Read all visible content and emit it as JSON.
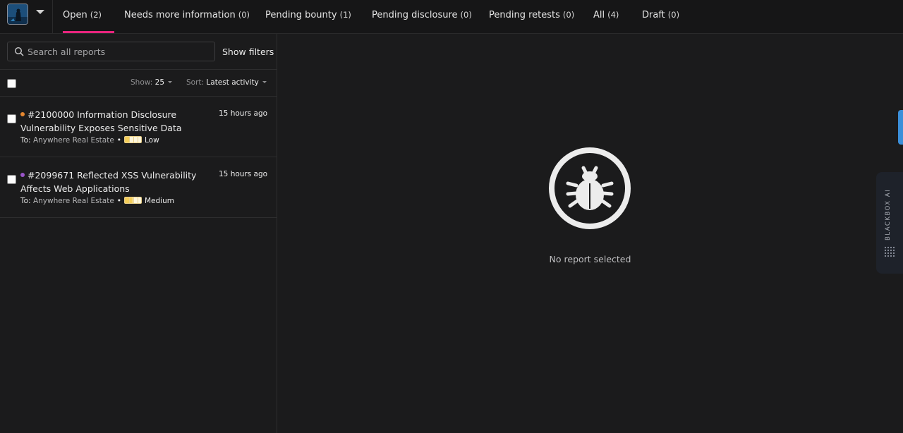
{
  "tabs": [
    {
      "label": "Open",
      "count": "(2)",
      "active": true
    },
    {
      "label": "Needs more information",
      "count": "(0)"
    },
    {
      "label": "Pending bounty",
      "count": "(1)"
    },
    {
      "label": "Pending disclosure",
      "count": "(0)"
    },
    {
      "label": "Pending retests",
      "count": "(0)"
    },
    {
      "label": "All",
      "count": "(4)"
    },
    {
      "label": "Draft",
      "count": "(0)"
    }
  ],
  "search": {
    "placeholder": "Search all reports",
    "value": ""
  },
  "filters_label": "Show filters",
  "list_controls": {
    "show_label": "Show:",
    "show_value": "25",
    "sort_label": "Sort:",
    "sort_value": "Latest activity"
  },
  "reports": [
    {
      "id": "#2100000",
      "title": "Information Disclosure Vulnerability Exposes Sensitive Data",
      "time": "15 hours ago",
      "to_label": "To:",
      "program": "Anywhere Real Estate",
      "severity": "Low",
      "severity_level": 0.25,
      "status_color": "#e5862f"
    },
    {
      "id": "#2099671",
      "title": "Reflected XSS Vulnerability Affects Web Applications",
      "time": "15 hours ago",
      "to_label": "To:",
      "program": "Anywhere Real Estate",
      "severity": "Medium",
      "severity_level": 0.5,
      "status_color": "#9a55c9"
    }
  ],
  "empty_state": {
    "icon": "bug-icon",
    "text": "No report selected"
  },
  "sidebar_widget": {
    "label": "BLACKBOX AI",
    "icon": "dot-grid-icon"
  },
  "colors": {
    "accent": "#e8247d",
    "handle": "#3b8fd9",
    "severity": "#f3cd5a"
  }
}
